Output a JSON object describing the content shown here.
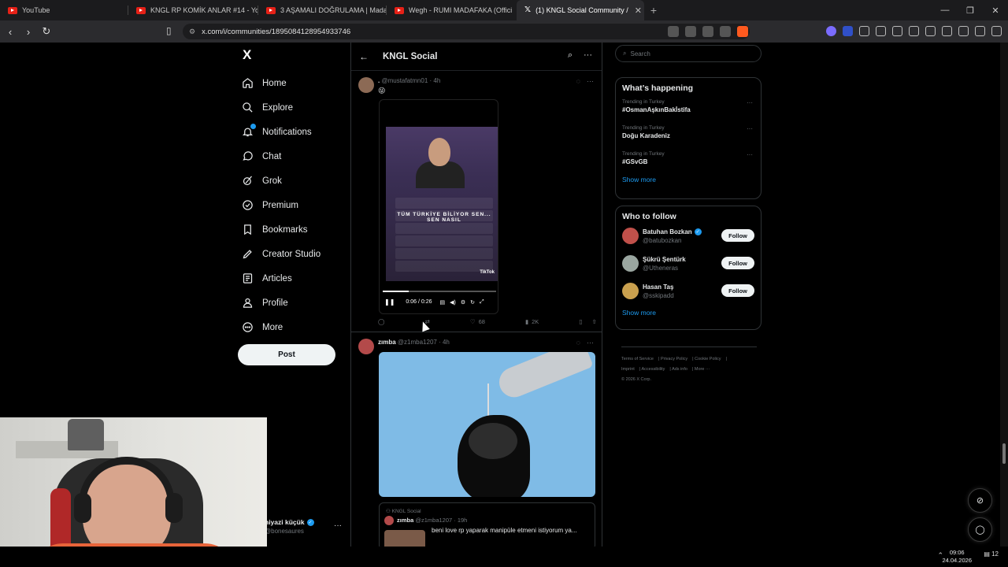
{
  "browser": {
    "tabs": [
      {
        "title": "YouTube",
        "type": "youtube",
        "active": false
      },
      {
        "title": "KNGL RP KOMİK ANLAR #14 - YouTu",
        "type": "youtube",
        "active": false
      },
      {
        "title": "3 AŞAMALI DOĞRULAMA | Madara C",
        "type": "youtube",
        "active": false
      },
      {
        "title": "Wegh - RUMI MADAFAKA (Offici",
        "type": "youtube",
        "active": false
      },
      {
        "title": "(1) KNGL Social Community /",
        "type": "x",
        "active": true
      }
    ],
    "url": "x.com/i/communities/1895084128954933746"
  },
  "nav": {
    "logo": "X",
    "items": [
      {
        "label": "Home",
        "icon": "home-icon"
      },
      {
        "label": "Explore",
        "icon": "search-icon"
      },
      {
        "label": "Notifications",
        "icon": "bell-icon"
      },
      {
        "label": "Chat",
        "icon": "chat-icon"
      },
      {
        "label": "Grok",
        "icon": "grok-icon"
      },
      {
        "label": "Premium",
        "icon": "premium-icon"
      },
      {
        "label": "Bookmarks",
        "icon": "bookmark-icon"
      },
      {
        "label": "Creator Studio",
        "icon": "creator-icon"
      },
      {
        "label": "Articles",
        "icon": "articles-icon"
      },
      {
        "label": "Profile",
        "icon": "profile-icon"
      },
      {
        "label": "More",
        "icon": "more-icon"
      }
    ],
    "post_label": "Post",
    "account": {
      "name": "niyazi küçük",
      "handle": "@bonesaures"
    }
  },
  "community": {
    "title": "KNGL Social"
  },
  "tweets": [
    {
      "author": ".",
      "handle": "@mustafatmn01",
      "time": "4h",
      "text": "😜",
      "video": {
        "banner": "TÜM TÜRKİYE BİLİYOR SEN... SEN NASIL",
        "time": "0:06 / 0:26",
        "progress": 0.23,
        "tiktok": "TikTok"
      },
      "actions": {
        "replies": "",
        "reposts": "",
        "likes": "68",
        "views": "2K"
      }
    },
    {
      "author": "zımba",
      "handle": "@z1mba1207",
      "time": "4h",
      "quote": {
        "community": "KNGL Social",
        "author": "zımba",
        "handle": "@z1mba1207",
        "time": "19h",
        "text": "beni love rp yaparak manipüle etmeni istiyorum ya..."
      }
    }
  ],
  "right": {
    "search_placeholder": "Search",
    "happening_title": "What’s happening",
    "trends": [
      {
        "context": "Trending in Turkey",
        "name": "#OsmanAşkınBakİstifa"
      },
      {
        "context": "Trending in Turkey",
        "name": "Doğu Karadeniz"
      },
      {
        "context": "Trending in Turkey",
        "name": "#GSvGB"
      }
    ],
    "show_more": "Show more",
    "follow_title": "Who to follow",
    "follow": [
      {
        "name": "Batuhan Bozkan",
        "handle": "@batubozkan",
        "verified": true,
        "button": "Follow"
      },
      {
        "name": "Şükrü Şentürk",
        "handle": "@Utheneras",
        "verified": false,
        "button": "Follow"
      },
      {
        "name": "Hasan Taş",
        "handle": "@sskipadd",
        "verified": false,
        "button": "Follow"
      }
    ],
    "footer": [
      "Terms of Service",
      "Privacy Policy",
      "Cookie Policy",
      "Imprint",
      "Accessibility",
      "Ads info",
      "More ···",
      "© 2026 X Corp."
    ]
  },
  "taskbar": {
    "time": "09:06",
    "date": "24.04.2026",
    "notif_count": "12"
  },
  "colors": {
    "accent": "#1d9bf0",
    "background": "#000000",
    "border": "#2f3336"
  }
}
